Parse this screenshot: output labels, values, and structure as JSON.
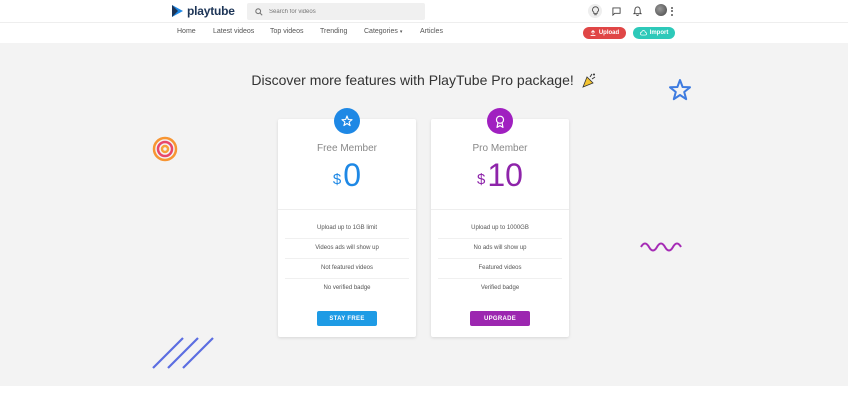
{
  "app": {
    "name": "playtube"
  },
  "search": {
    "placeholder": "Search for videos"
  },
  "header_icons": [
    "lightbulb-icon",
    "message-icon",
    "bell-icon"
  ],
  "nav": {
    "items": [
      {
        "label": "Home"
      },
      {
        "label": "Latest videos"
      },
      {
        "label": "Top videos"
      },
      {
        "label": "Trending"
      },
      {
        "label": "Categories"
      },
      {
        "label": "Articles"
      }
    ],
    "upload_label": "Upload",
    "import_label": "Import"
  },
  "hero": {
    "title": "Discover more features with PlayTube Pro package!"
  },
  "plans": {
    "free": {
      "title": "Free Member",
      "currency": "$",
      "price": "0",
      "features": [
        "Upload up to 1GB limit",
        "Videos ads will show up",
        "Not featured videos",
        "No verified badge"
      ],
      "button": "STAY FREE"
    },
    "pro": {
      "title": "Pro Member",
      "currency": "$",
      "price": "10",
      "features": [
        "Upload up to 1000GB",
        "No ads will show up",
        "Featured videos",
        "Verified badge"
      ],
      "button": "UPGRADE"
    }
  },
  "colors": {
    "free": "#1e88e5",
    "pro": "#9c27b0",
    "upload": "#e04646",
    "import": "#2dc9b9"
  }
}
